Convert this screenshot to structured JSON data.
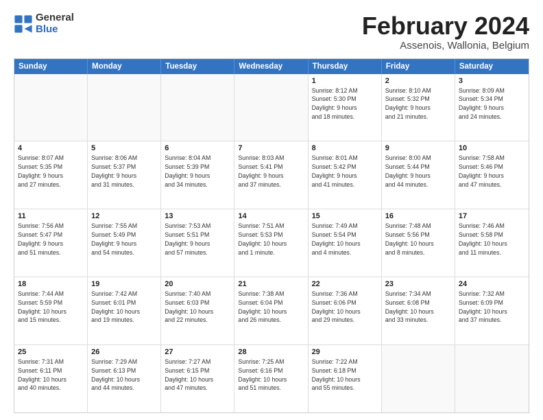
{
  "header": {
    "logo": {
      "general": "General",
      "blue": "Blue"
    },
    "month_title": "February 2024",
    "subtitle": "Assenois, Wallonia, Belgium"
  },
  "calendar": {
    "days_of_week": [
      "Sunday",
      "Monday",
      "Tuesday",
      "Wednesday",
      "Thursday",
      "Friday",
      "Saturday"
    ],
    "weeks": [
      [
        {
          "day": "",
          "empty": true
        },
        {
          "day": "",
          "empty": true
        },
        {
          "day": "",
          "empty": true
        },
        {
          "day": "",
          "empty": true
        },
        {
          "day": "1",
          "info": "Sunrise: 8:12 AM\nSunset: 5:30 PM\nDaylight: 9 hours\nand 18 minutes."
        },
        {
          "day": "2",
          "info": "Sunrise: 8:10 AM\nSunset: 5:32 PM\nDaylight: 9 hours\nand 21 minutes."
        },
        {
          "day": "3",
          "info": "Sunrise: 8:09 AM\nSunset: 5:34 PM\nDaylight: 9 hours\nand 24 minutes."
        }
      ],
      [
        {
          "day": "4",
          "info": "Sunrise: 8:07 AM\nSunset: 5:35 PM\nDaylight: 9 hours\nand 27 minutes."
        },
        {
          "day": "5",
          "info": "Sunrise: 8:06 AM\nSunset: 5:37 PM\nDaylight: 9 hours\nand 31 minutes."
        },
        {
          "day": "6",
          "info": "Sunrise: 8:04 AM\nSunset: 5:39 PM\nDaylight: 9 hours\nand 34 minutes."
        },
        {
          "day": "7",
          "info": "Sunrise: 8:03 AM\nSunset: 5:41 PM\nDaylight: 9 hours\nand 37 minutes."
        },
        {
          "day": "8",
          "info": "Sunrise: 8:01 AM\nSunset: 5:42 PM\nDaylight: 9 hours\nand 41 minutes."
        },
        {
          "day": "9",
          "info": "Sunrise: 8:00 AM\nSunset: 5:44 PM\nDaylight: 9 hours\nand 44 minutes."
        },
        {
          "day": "10",
          "info": "Sunrise: 7:58 AM\nSunset: 5:46 PM\nDaylight: 9 hours\nand 47 minutes."
        }
      ],
      [
        {
          "day": "11",
          "info": "Sunrise: 7:56 AM\nSunset: 5:47 PM\nDaylight: 9 hours\nand 51 minutes."
        },
        {
          "day": "12",
          "info": "Sunrise: 7:55 AM\nSunset: 5:49 PM\nDaylight: 9 hours\nand 54 minutes."
        },
        {
          "day": "13",
          "info": "Sunrise: 7:53 AM\nSunset: 5:51 PM\nDaylight: 9 hours\nand 57 minutes."
        },
        {
          "day": "14",
          "info": "Sunrise: 7:51 AM\nSunset: 5:53 PM\nDaylight: 10 hours\nand 1 minute."
        },
        {
          "day": "15",
          "info": "Sunrise: 7:49 AM\nSunset: 5:54 PM\nDaylight: 10 hours\nand 4 minutes."
        },
        {
          "day": "16",
          "info": "Sunrise: 7:48 AM\nSunset: 5:56 PM\nDaylight: 10 hours\nand 8 minutes."
        },
        {
          "day": "17",
          "info": "Sunrise: 7:46 AM\nSunset: 5:58 PM\nDaylight: 10 hours\nand 11 minutes."
        }
      ],
      [
        {
          "day": "18",
          "info": "Sunrise: 7:44 AM\nSunset: 5:59 PM\nDaylight: 10 hours\nand 15 minutes."
        },
        {
          "day": "19",
          "info": "Sunrise: 7:42 AM\nSunset: 6:01 PM\nDaylight: 10 hours\nand 19 minutes."
        },
        {
          "day": "20",
          "info": "Sunrise: 7:40 AM\nSunset: 6:03 PM\nDaylight: 10 hours\nand 22 minutes."
        },
        {
          "day": "21",
          "info": "Sunrise: 7:38 AM\nSunset: 6:04 PM\nDaylight: 10 hours\nand 26 minutes."
        },
        {
          "day": "22",
          "info": "Sunrise: 7:36 AM\nSunset: 6:06 PM\nDaylight: 10 hours\nand 29 minutes."
        },
        {
          "day": "23",
          "info": "Sunrise: 7:34 AM\nSunset: 6:08 PM\nDaylight: 10 hours\nand 33 minutes."
        },
        {
          "day": "24",
          "info": "Sunrise: 7:32 AM\nSunset: 6:09 PM\nDaylight: 10 hours\nand 37 minutes."
        }
      ],
      [
        {
          "day": "25",
          "info": "Sunrise: 7:31 AM\nSunset: 6:11 PM\nDaylight: 10 hours\nand 40 minutes."
        },
        {
          "day": "26",
          "info": "Sunrise: 7:29 AM\nSunset: 6:13 PM\nDaylight: 10 hours\nand 44 minutes."
        },
        {
          "day": "27",
          "info": "Sunrise: 7:27 AM\nSunset: 6:15 PM\nDaylight: 10 hours\nand 47 minutes."
        },
        {
          "day": "28",
          "info": "Sunrise: 7:25 AM\nSunset: 6:16 PM\nDaylight: 10 hours\nand 51 minutes."
        },
        {
          "day": "29",
          "info": "Sunrise: 7:22 AM\nSunset: 6:18 PM\nDaylight: 10 hours\nand 55 minutes."
        },
        {
          "day": "",
          "empty": true
        },
        {
          "day": "",
          "empty": true
        }
      ]
    ]
  }
}
